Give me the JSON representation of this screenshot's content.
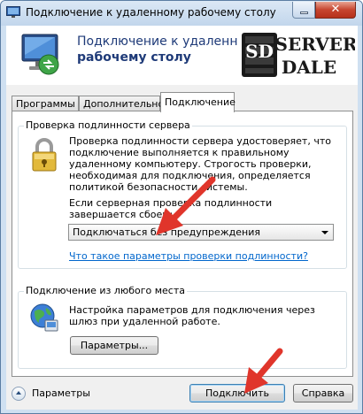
{
  "window": {
    "title": "Подключение к удаленному рабочему столу",
    "minimize_icon": "minimize-icon",
    "close_icon": "close-icon"
  },
  "banner": {
    "title_line1": "Подключение к удаленному",
    "title_line2": "рабочему столу",
    "logo_text_left": "SD",
    "logo_text_top": "SERVER",
    "logo_text_bottom": "DALE",
    "accent_color": "#1e3a78"
  },
  "tabs": [
    {
      "label": "Программы",
      "active": false
    },
    {
      "label": "Дополнительно",
      "active": false
    },
    {
      "label": "Подключение",
      "active": true
    }
  ],
  "server_auth": {
    "legend": "Проверка подлинности сервера",
    "description": "Проверка подлинности сервера удостоверяет, что подключение выполняется к правильному удаленному компьютеру. Строгость проверки, необходимая для подключения, определяется политикой безопасности системы.",
    "prompt": "Если серверная проверка подлинности завершается сбоем:",
    "selected_option": "Подключаться без предупреждения",
    "help_link": "Что такое параметры проверки подлинности?",
    "icon": "lock-icon"
  },
  "connect_anywhere": {
    "legend": "Подключение из любого места",
    "description": "Настройка параметров для подключения через шлюз при удаленной работе.",
    "button_label": "Параметры...",
    "icon": "globe-icon"
  },
  "footer": {
    "options_label": "Параметры",
    "connect_label": "Подключить",
    "help_label": "Справка"
  },
  "annotation_color": "#e0352b"
}
